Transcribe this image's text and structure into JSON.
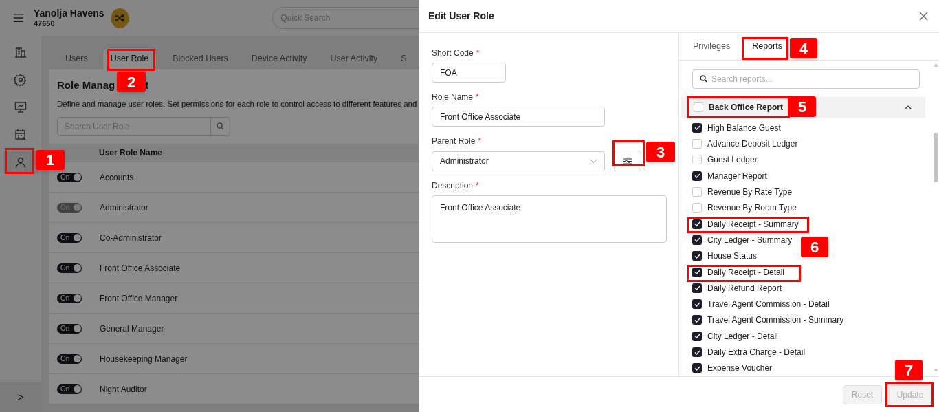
{
  "app": {
    "property_name": "Yanolja Havens",
    "property_code": "47650",
    "search_placeholder": "Quick Search"
  },
  "sidebar": {
    "items": [
      {
        "selected": false
      },
      {
        "selected": false
      },
      {
        "selected": false
      },
      {
        "selected": false
      },
      {
        "selected": true
      }
    ],
    "expand_glyph": ">"
  },
  "tabs": [
    {
      "label": "Users",
      "selected": false
    },
    {
      "label": "User Role",
      "selected": true
    },
    {
      "label": "Blocked Users",
      "selected": false
    },
    {
      "label": "Device Activity",
      "selected": false
    },
    {
      "label": "User Activity",
      "selected": false
    },
    {
      "label": "S",
      "selected": false
    }
  ],
  "role_management": {
    "title": "Role Manag",
    "title_tail": "t",
    "description": "Define and manage user roles. Set permissions for each role to control access to different features and",
    "search_placeholder": "Search User Role",
    "columns": [
      "User Role Name"
    ],
    "rows": [
      {
        "toggle": "On",
        "disabled": false,
        "name": "Accounts"
      },
      {
        "toggle": "On",
        "disabled": true,
        "name": "Administrator"
      },
      {
        "toggle": "On",
        "disabled": false,
        "name": "Co-Administrator"
      },
      {
        "toggle": "On",
        "disabled": false,
        "name": "Front Office Associate"
      },
      {
        "toggle": "On",
        "disabled": false,
        "name": "Front Office Manager"
      },
      {
        "toggle": "On",
        "disabled": false,
        "name": "General Manager"
      },
      {
        "toggle": "On",
        "disabled": false,
        "name": "Housekeeping Manager"
      },
      {
        "toggle": "On",
        "disabled": false,
        "name": "Night Auditor"
      }
    ]
  },
  "drawer": {
    "title": "Edit User Role",
    "fields": [
      {
        "label": "Short Code",
        "required": true,
        "kind": "short",
        "value": "FOA"
      },
      {
        "label": "Role Name",
        "required": true,
        "kind": "text",
        "value": "Front Office Associate"
      },
      {
        "label": "Parent Role",
        "required": true,
        "kind": "select",
        "value": "Administrator"
      },
      {
        "label": "Description",
        "required": true,
        "kind": "textarea",
        "value": "Front Office Associate"
      }
    ],
    "required_mark": "*",
    "panel_tabs": [
      {
        "label": "Privileges",
        "selected": false
      },
      {
        "label": "Reports",
        "selected": true
      }
    ],
    "reports_search_placeholder": "Search reports...",
    "group": {
      "label": "Back Office Report",
      "checked": false,
      "expanded": true,
      "items": [
        {
          "label": "High Balance Guest",
          "checked": true
        },
        {
          "label": "Advance Deposit Ledger",
          "checked": false
        },
        {
          "label": "Guest Ledger",
          "checked": false
        },
        {
          "label": "Manager Report",
          "checked": true
        },
        {
          "label": "Revenue By Rate Type",
          "checked": false
        },
        {
          "label": "Revenue By Room Type",
          "checked": false
        },
        {
          "label": "Daily Receipt - Summary",
          "checked": true
        },
        {
          "label": "City Ledger - Summary",
          "checked": true
        },
        {
          "label": "House Status",
          "checked": true
        },
        {
          "label": "Daily Receipt - Detail",
          "checked": true
        },
        {
          "label": "Daily Refund Report",
          "checked": true
        },
        {
          "label": "Travel Agent Commission - Detail",
          "checked": true
        },
        {
          "label": "Travel Agent Commission - Summary",
          "checked": true
        },
        {
          "label": "City Ledger - Detail",
          "checked": true
        },
        {
          "label": "Daily Extra Charge - Detail",
          "checked": true
        },
        {
          "label": "Expense Voucher",
          "checked": true
        }
      ]
    },
    "buttons": [
      {
        "label": "Reset",
        "disabled": true
      },
      {
        "label": "Update",
        "disabled": true
      }
    ]
  },
  "annotations": [
    {
      "label": "1"
    },
    {
      "label": "2"
    },
    {
      "label": "3"
    },
    {
      "label": "4"
    },
    {
      "label": "5"
    },
    {
      "label": "6"
    },
    {
      "label": "7"
    }
  ]
}
